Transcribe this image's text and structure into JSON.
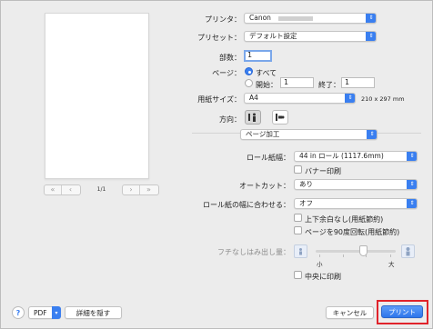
{
  "printer": {
    "label": "プリンタ：",
    "value": "Canon"
  },
  "presets": {
    "label": "プリセット：",
    "value": "デフォルト設定"
  },
  "copies": {
    "label": "部数：",
    "value": "1"
  },
  "pages": {
    "label": "ページ：",
    "all": "すべて",
    "from_label": "開始：",
    "from_value": "1",
    "to_label": "終了：",
    "to_value": "1"
  },
  "paper_size": {
    "label": "用紙サイズ：",
    "value": "A4",
    "dims": "210 x 297 mm"
  },
  "orientation": {
    "label": "方向：",
    "selected": "portrait"
  },
  "section": {
    "value": "ページ加工"
  },
  "roll_width": {
    "label": "ロール紙幅：",
    "value": "44 in ロール (1117.6mm)"
  },
  "banner": {
    "label": "バナー印刷"
  },
  "auto_cut": {
    "label": "オートカット：",
    "value": "あり"
  },
  "fit_roll": {
    "label": "ロール紙の幅に合わせる：",
    "value": "オフ"
  },
  "no_margin_tb": {
    "label": "上下余白なし(用紙節約)"
  },
  "rotate90": {
    "label": "ページを90度回転(用紙節約)"
  },
  "overflow": {
    "label": "フチなしはみ出し量：",
    "small": "小",
    "large": "大",
    "level": 0.6
  },
  "center_print": {
    "label": "中央に印刷"
  },
  "preview": {
    "page_indicator": "1/1"
  },
  "footer": {
    "help": "?",
    "pdf": "PDF",
    "hide_details": "詳細を隠す",
    "cancel": "キャンセル",
    "print": "プリント"
  },
  "colors": {
    "accent": "#3a7ff0",
    "highlight": "#e0232b"
  }
}
